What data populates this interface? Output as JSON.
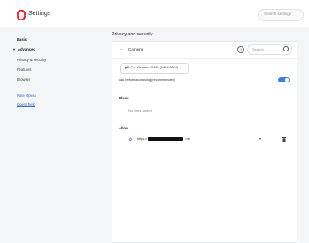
{
  "app": {
    "title": "Settings",
    "search_placeholder": "Search settings",
    "brand_color": "#e8202a"
  },
  "sidebar": {
    "items": [
      {
        "label": "Basic"
      },
      {
        "label": "Advanced"
      },
      {
        "label": "Privacy & security"
      },
      {
        "label": "Features"
      },
      {
        "label": "Browser"
      }
    ],
    "links": [
      {
        "label": "Rate Opera"
      },
      {
        "label": "Opera help"
      }
    ]
  },
  "main": {
    "section_title": "Privacy and security",
    "camera": {
      "title": "Camera",
      "help_glyph": "?",
      "search_placeholder": "Search",
      "device_selected": "HD Pro Webcam C920 (046d:082d)",
      "ask_label": "Ask before accessing (recommended)",
      "ask_enabled": true,
      "block_label": "Block",
      "block_empty": "No sites added",
      "allow_label": "Allow",
      "allowed_sites": [
        {
          "url_prefix": "https://",
          "url_suffix": ".net"
        }
      ],
      "accent_color": "#3b82e0"
    }
  }
}
